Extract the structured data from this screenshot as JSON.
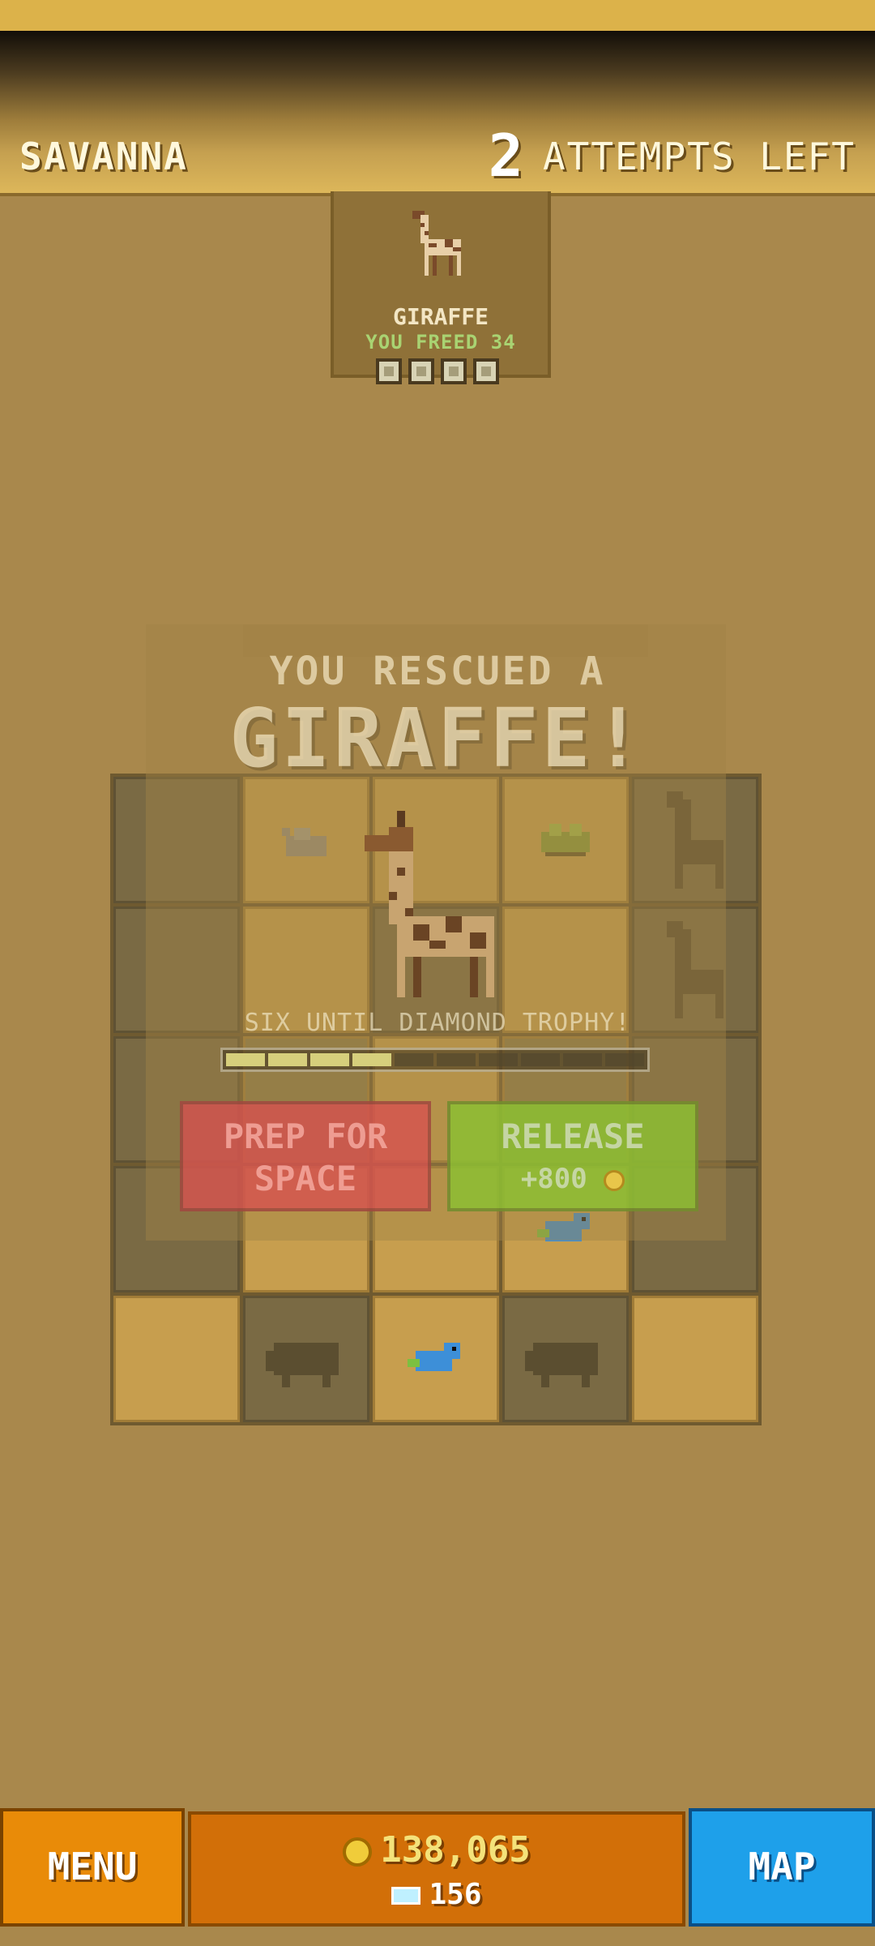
{
  "header": {
    "level_name": "SAVANNA",
    "attempts_left": "2",
    "attempts_label": "ATTEMPTS LEFT"
  },
  "animal_card": {
    "name": "GIRAFFE",
    "freed_text": "YOU FREED 34",
    "progress_boxes_filled": 0,
    "progress_boxes_total": 4
  },
  "popup": {
    "line1": "YOU RESCUED A",
    "line2": "GIRAFFE!",
    "trophy_text": "SIX UNTIL DIAMOND TROPHY!",
    "trophy_progress": {
      "filled": 4,
      "total": 10
    },
    "prep_button": "PREP FOR SPACE",
    "release_button": "RELEASE",
    "release_reward": "+800"
  },
  "footer": {
    "menu_label": "MENU",
    "coins": "138,065",
    "gems": "156",
    "map_label": "MAP"
  },
  "colors": {
    "background": "#a9884c",
    "menu": "#e98b08",
    "map": "#1ea0ea",
    "prep": "#d75050",
    "release": "#8cbe32"
  },
  "icons": [
    "giraffe-icon",
    "coin-icon",
    "gem-icon",
    "rock-icon",
    "bush-icon",
    "bird-icon",
    "hippo-silhouette-icon"
  ]
}
